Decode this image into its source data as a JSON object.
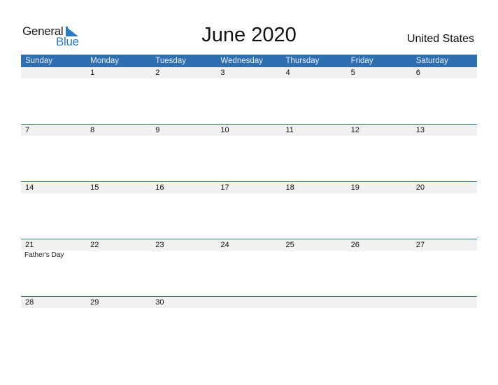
{
  "logo": {
    "word1": "General",
    "word2": "Blue"
  },
  "title": "June 2020",
  "country": "United States",
  "colors": {
    "header": "#2e6fb2",
    "date_strip": "#f1f1f1",
    "logo_blue": "#2a7bc4"
  },
  "weekdays": [
    "Sunday",
    "Monday",
    "Tuesday",
    "Wednesday",
    "Thursday",
    "Friday",
    "Saturday"
  ],
  "weeks": [
    {
      "days": [
        "",
        "1",
        "2",
        "3",
        "4",
        "5",
        "6"
      ],
      "events": [
        "",
        "",
        "",
        "",
        "",
        "",
        ""
      ]
    },
    {
      "days": [
        "7",
        "8",
        "9",
        "10",
        "11",
        "12",
        "13"
      ],
      "events": [
        "",
        "",
        "",
        "",
        "",
        "",
        ""
      ]
    },
    {
      "days": [
        "14",
        "15",
        "16",
        "17",
        "18",
        "19",
        "20"
      ],
      "events": [
        "",
        "",
        "",
        "",
        "",
        "",
        ""
      ]
    },
    {
      "days": [
        "21",
        "22",
        "23",
        "24",
        "25",
        "26",
        "27"
      ],
      "events": [
        "Father's Day",
        "",
        "",
        "",
        "",
        "",
        ""
      ]
    },
    {
      "days": [
        "28",
        "29",
        "30",
        "",
        "",
        "",
        ""
      ],
      "events": [
        "",
        "",
        "",
        "",
        "",
        "",
        ""
      ]
    }
  ]
}
